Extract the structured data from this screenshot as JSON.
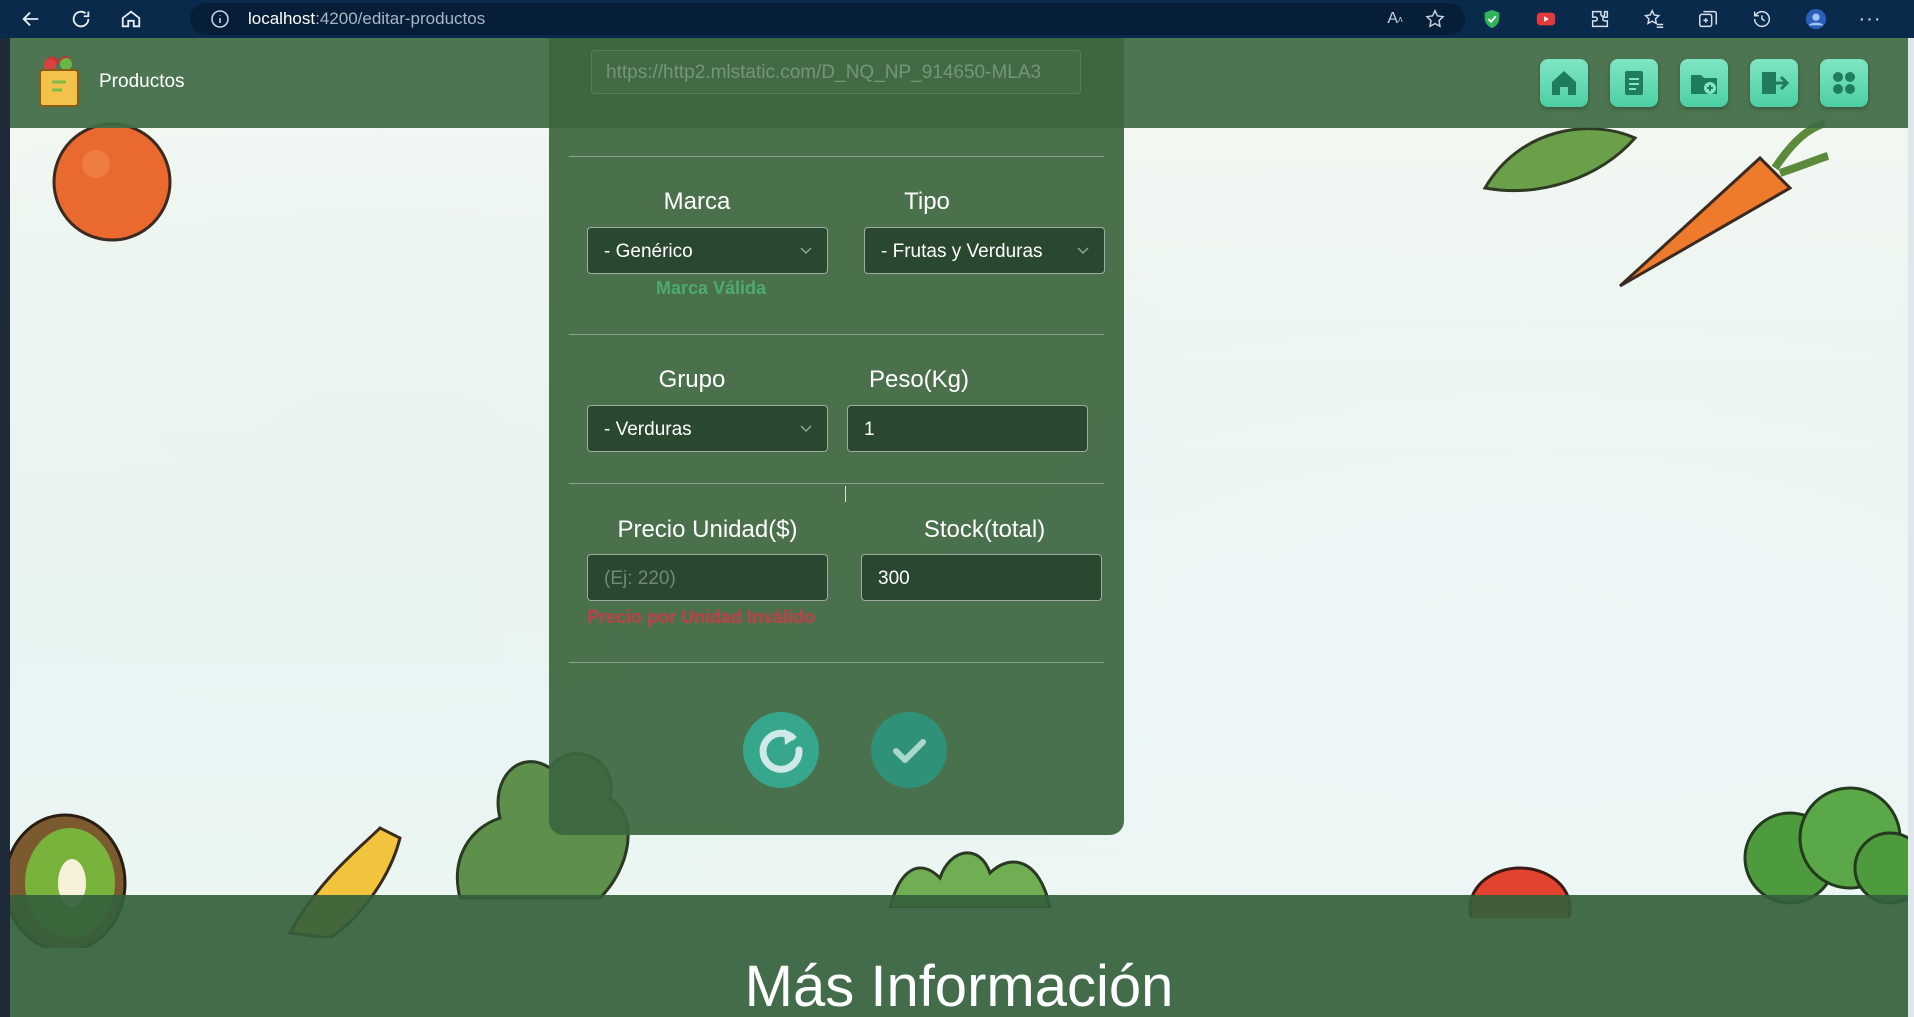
{
  "browser": {
    "url_host": "localhost",
    "url_path": ":4200/editar-productos"
  },
  "appbar": {
    "title": "Productos",
    "nav_icons": [
      "home-icon",
      "list-icon",
      "add-folder-icon",
      "logout-icon",
      "apps-icon"
    ]
  },
  "form": {
    "image_url_value": "https://http2.mlstatic.com/D_NQ_NP_914650-MLA3",
    "marca": {
      "label": "Marca",
      "value": "- Genérico",
      "valid_msg": "Marca Válida"
    },
    "tipo": {
      "label": "Tipo",
      "value": "- Frutas y Verduras"
    },
    "grupo": {
      "label": "Grupo",
      "value": "- Verduras"
    },
    "peso": {
      "label": "Peso(Kg)",
      "value": "1"
    },
    "precio": {
      "label": "Precio Unidad($)",
      "placeholder": "(Ej: 220)",
      "error_msg": "Precio por Unidad Inválido"
    },
    "stock": {
      "label": "Stock(total)",
      "value": "300"
    },
    "reset_icon": "refresh-icon",
    "save_icon": "check-icon"
  },
  "footer": {
    "title": "Más Información"
  },
  "colors": {
    "chrome": "#0a2a4c",
    "appbar": "#3f6b45",
    "card": "#3d6640",
    "accent": "#4ccfa3",
    "valid": "#4cab72",
    "error": "#c43f4a"
  }
}
